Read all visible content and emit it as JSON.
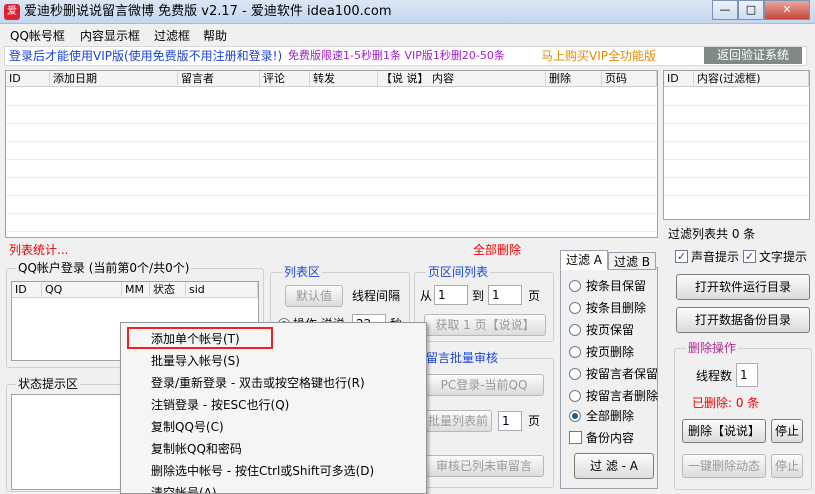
{
  "window": {
    "title": "爱迪秒删说说留言微博 免费版 v2.17 - 爱迪软件 idea100.com",
    "min": "—",
    "max": "□",
    "close": "✕"
  },
  "menu": [
    "QQ帐号框",
    "内容显示框",
    "过滤框",
    "帮助"
  ],
  "info": {
    "vip_notice": "登录后才能使用VIP版(使用免费版不用注册和登录!)",
    "free_speed": "免费版限速1-5秒删1条 VIP版1秒删20-50条",
    "buy": "马上购买VIP全功能版",
    "verify": "返回验证系统"
  },
  "main_table": {
    "columns": [
      "ID",
      "添加日期",
      "留言者",
      "评论",
      "转发",
      "【说 说】 内容",
      "删除",
      "页码"
    ]
  },
  "filter_table": {
    "columns": [
      "ID",
      "内容(过滤框)"
    ],
    "summary": "过滤列表共 0 条"
  },
  "list_stats": "列表统计...",
  "delete_all": "全部删除",
  "qq_group": {
    "title": "QQ帐户登录 (当前第0个/共0个)",
    "columns": [
      "ID",
      "QQ",
      "MM",
      "状态",
      "sid"
    ]
  },
  "status_group": {
    "title": "状态提示区"
  },
  "list_area": {
    "title": "列表区",
    "default_btn": "默认值",
    "interval": "线程间隔",
    "option": "操作 说说",
    "interval_val": "22",
    "unit": "秒"
  },
  "page_range": {
    "title": "页区间列表",
    "from": "从",
    "from_val": "1",
    "to": "到",
    "to_val": "1",
    "page": "页",
    "fetch": "获取 1 页【说说】"
  },
  "batch": {
    "title": "留言批量审核",
    "pc_login": "PC登录-当前QQ",
    "batch_list": "批量列表前",
    "batch_val": "1",
    "page": "页",
    "review": "审核已列未审留言"
  },
  "filter_tabs": [
    "过滤 A",
    "过滤 B"
  ],
  "filter_options": [
    {
      "label": "按条目保留",
      "type": "radio",
      "on": false
    },
    {
      "label": "按条目删除",
      "type": "radio",
      "on": false
    },
    {
      "label": "按页保留",
      "type": "radio",
      "on": false
    },
    {
      "label": "按页删除",
      "type": "radio",
      "on": false
    },
    {
      "label": "按留言者保留",
      "type": "radio",
      "on": false
    },
    {
      "label": "按留言者删除",
      "type": "radio",
      "on": false
    },
    {
      "label": "全部删除",
      "type": "radio",
      "on": true
    },
    {
      "label": "备份内容",
      "type": "check",
      "on": false
    }
  ],
  "filter_btn": "过 滤 - A",
  "right": {
    "sound": "声音提示",
    "text_tip": "文字提示",
    "open_dir": "打开软件运行目录",
    "open_backup": "打开数据备份目录",
    "delete_ops": "删除操作",
    "threads": "线程数",
    "threads_val": "1",
    "deleted": "已删除: 0 条",
    "delete_btn": "删除【说说】",
    "stop": "停止",
    "one_click": "一键删除动态",
    "stop2": "停止"
  },
  "context_menu": [
    "添加单个帐号(T)",
    "批量导入帐号(S)",
    "登录/重新登录 - 双击或按空格键也行(R)",
    "注销登录 - 按ESC也行(Q)",
    "复制QQ号(C)",
    "复制帐QQ和密码",
    "删除选中帐号 - 按住Ctrl或Shift可多选(D)",
    "清空帐号(A)"
  ],
  "check_mark": "✓",
  "colors": {
    "title_bg": "#c4d7ef",
    "notice_blue": "#1a44d8",
    "notice_purple": "#a21ccc",
    "buy_orange": "#e08a00",
    "alert_red": "#e00"
  }
}
